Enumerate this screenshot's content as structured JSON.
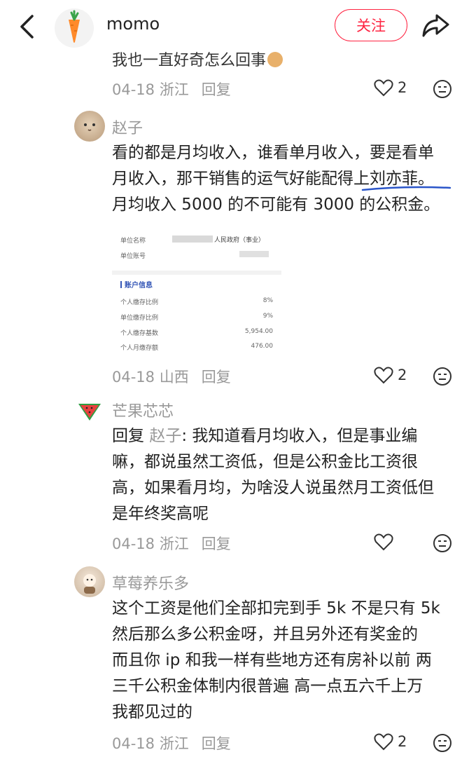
{
  "header": {
    "username": "momo",
    "follow_label": "关注",
    "avatar_icon": "carrot-icon"
  },
  "comments": [
    {
      "partial_text": "我也一直好奇怎么回事",
      "date": "04-18",
      "region": "浙江",
      "reply": "回复",
      "likes": "2"
    },
    {
      "name": "赵子",
      "lines": [
        "看的都是月均收入，谁看单月收入，要是看单",
        "月收入，那干销售的运气好能配得上刘亦菲。",
        "月均收入 5000 的不可能有 3000 的公积金。"
      ],
      "date": "04-18",
      "region": "山西",
      "reply": "回复",
      "likes": "2",
      "card": {
        "unit_name_label": "单位名称",
        "unit_name_value": "人民政府（事业）",
        "unit_account_label": "单位账号",
        "section": "账户信息",
        "rows": [
          {
            "label": "个人缴存比例",
            "value": "8%"
          },
          {
            "label": "单位缴存比例",
            "value": "9%"
          },
          {
            "label": "个人缴存基数",
            "value": "5,954.00"
          },
          {
            "label": "个人月缴存额",
            "value": "476.00"
          }
        ]
      }
    },
    {
      "name": "芒果芯芯",
      "reply_prefix": "回复",
      "mention": "赵子",
      "first_line_rest": ": 我知道看月均收入，但是事业编",
      "lines": [
        "嘛，都说虽然工资低，但是公积金比工资很",
        "高，如果看月均，为啥没人说虽然月工资低但",
        "是年终奖高呢"
      ],
      "date": "04-18",
      "region": "浙江",
      "reply": "回复",
      "avatar_icon": "watermelon-icon"
    },
    {
      "name": "草莓养乐多",
      "lines": [
        "这个工资是他们全部扣完到手 5k 不是只有 5k",
        "然后那么多公积金呀，并且另外还有奖金的",
        "而且你 ip 和我一样有些地方还有房补以前 两",
        "三千公积金体制内很普遍 高一点五六千上万",
        "我都见过的"
      ],
      "date": "04-18",
      "region": "浙江",
      "reply": "回复",
      "likes": "2"
    }
  ],
  "colors": {
    "accent": "#ff2442",
    "meta": "#999999",
    "underline": "#2a55c9",
    "watermelon": "#e8413e"
  }
}
